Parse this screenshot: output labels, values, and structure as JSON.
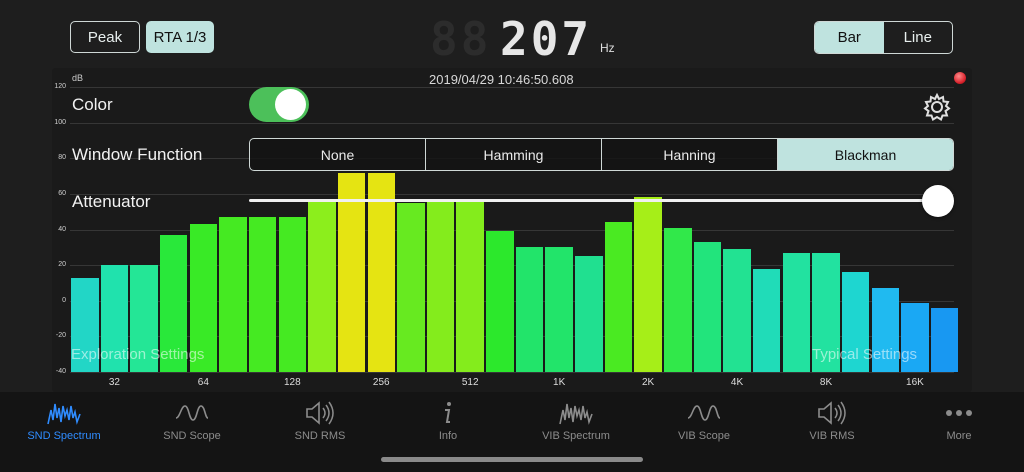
{
  "header": {
    "peak_label": "Peak",
    "rta_label": "RTA 1/3",
    "freq_ghost": "88",
    "freq_value": "207",
    "freq_unit": "Hz",
    "mode_bar_label": "Bar",
    "mode_line_label": "Line",
    "active_mode": "Bar"
  },
  "graph": {
    "db_unit": "dB",
    "timestamp": "2019/04/29 10:46:50.608",
    "recording_indicator_color": "#d8202a"
  },
  "settings": {
    "color_label": "Color",
    "color_enabled": true,
    "window_function_label": "Window Function",
    "window_options": [
      "None",
      "Hamming",
      "Hanning",
      "Blackman"
    ],
    "window_selected": "Blackman",
    "attenuator_label": "Attenuator",
    "attenuator_level": 1.0,
    "exploration_label": "Exploration Settings",
    "typical_label": "Typical Settings",
    "gear_icon": "gear-icon"
  },
  "chart_data": {
    "type": "bar",
    "ylabel": "dB",
    "ylim": [
      -40,
      120
    ],
    "yticks": [
      120,
      100,
      80,
      60,
      40,
      20,
      0,
      -20,
      -40
    ],
    "xtick_labels": [
      "32",
      "64",
      "128",
      "256",
      "512",
      "1K",
      "2K",
      "4K",
      "8K",
      "16K"
    ],
    "values": [
      13,
      20,
      20,
      37,
      43,
      47,
      47,
      47,
      56,
      72,
      72,
      55,
      56,
      56,
      39,
      30,
      30,
      25,
      44,
      58,
      41,
      33,
      29,
      18,
      27,
      27,
      16,
      7,
      -1,
      -4
    ],
    "colors": [
      "#22d6c6",
      "#20e2ad",
      "#24e696",
      "#29e83a",
      "#39ea26",
      "#45ea22",
      "#45ea22",
      "#45ea22",
      "#8cee1c",
      "#e5e412",
      "#e5e412",
      "#67ea20",
      "#84ec1c",
      "#84ec1c",
      "#2ce82c",
      "#22e46a",
      "#22e46a",
      "#20e090",
      "#4aea22",
      "#a6ee18",
      "#31e84a",
      "#22e47c",
      "#22e292",
      "#20dcb8",
      "#22e2a0",
      "#22e2a0",
      "#1ed6d0",
      "#20baf0",
      "#1aa8f4",
      "#1898f2"
    ]
  },
  "tabbar": {
    "active": "SND Spectrum",
    "tabs": [
      {
        "label": "SND Spectrum",
        "icon": "spectrum-icon"
      },
      {
        "label": "SND Scope",
        "icon": "waveform-icon"
      },
      {
        "label": "SND RMS",
        "icon": "speaker-icon"
      },
      {
        "label": "Info",
        "icon": "info-icon"
      },
      {
        "label": "VIB Spectrum",
        "icon": "spectrum-icon"
      },
      {
        "label": "VIB Scope",
        "icon": "waveform-icon"
      },
      {
        "label": "VIB RMS",
        "icon": "speaker-icon"
      },
      {
        "label": "More",
        "icon": "more-icon"
      }
    ]
  }
}
